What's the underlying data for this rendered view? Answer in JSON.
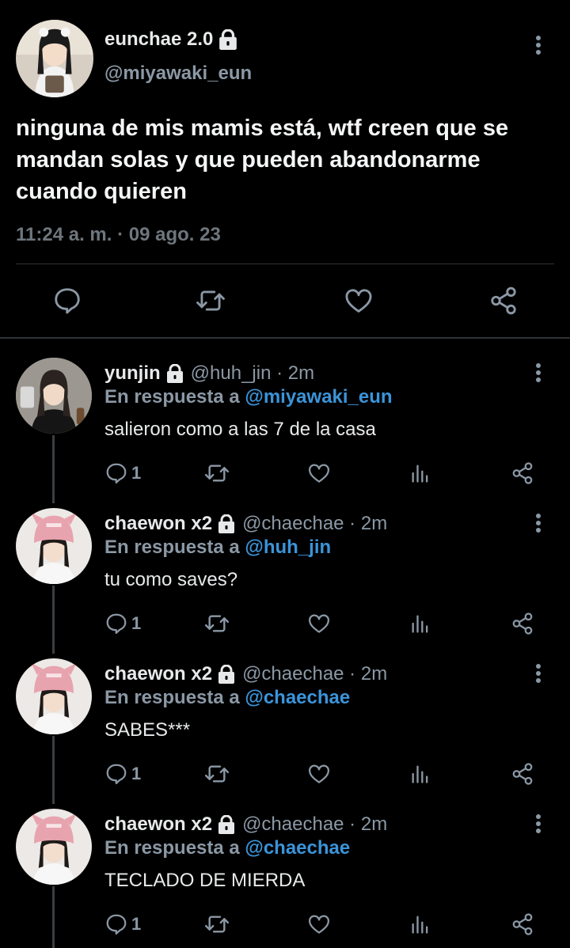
{
  "colors": {
    "background": "#000000",
    "text": "#e7e9ea",
    "muted": "#8b98a5",
    "link": "#3b94d9",
    "divider": "#2f3336"
  },
  "main_tweet": {
    "name": "eunchae 2.0",
    "handle": "@miyawaki_eun",
    "text": "ninguna de mis mamis está, wtf creen que se mandan solas y que pueden abandonarme cuando quieren",
    "timestamp": "11:24 a. m. · 09 ago. 23",
    "icons": [
      "lock-icon",
      "more-icon",
      "reply-icon",
      "retweet-icon",
      "like-icon",
      "share-icon"
    ]
  },
  "replies": [
    {
      "name": "yunjin",
      "handle": "@huh_jin · 2m",
      "reply_prefix": "En respuesta a ",
      "reply_to": "@miyawaki_eun",
      "text": "salieron como a las 7 de la casa",
      "reply_count": "1"
    },
    {
      "name": "chaewon x2",
      "handle": "@chaechae · 2m",
      "reply_prefix": "En respuesta a ",
      "reply_to": "@huh_jin",
      "text": "tu como saves?",
      "reply_count": "1"
    },
    {
      "name": "chaewon x2",
      "handle": "@chaechae · 2m",
      "reply_prefix": "En respuesta a ",
      "reply_to": "@chaechae",
      "text": "SABES***",
      "reply_count": "1"
    },
    {
      "name": "chaewon x2",
      "handle": "@chaechae · 2m",
      "reply_prefix": "En respuesta a ",
      "reply_to": "@chaechae",
      "text": "TECLADO DE MIERDA",
      "reply_count": "1"
    }
  ]
}
